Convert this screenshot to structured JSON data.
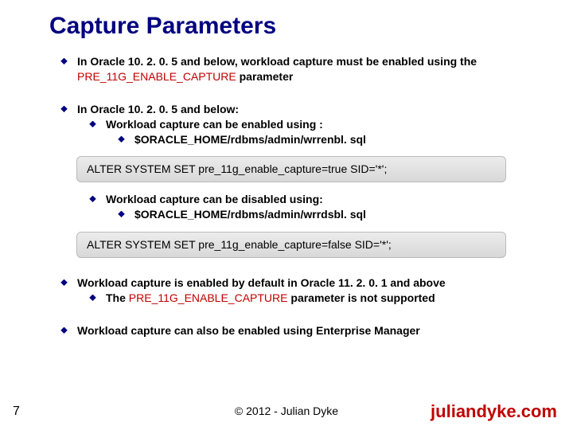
{
  "title": "Capture Parameters",
  "b1": {
    "pre": "In Oracle 10. 2. 0. 5 and below, workload capture must be enabled using the ",
    "param": "PRE_11G_ENABLE_CAPTURE",
    "post": " parameter"
  },
  "b2": "In Oracle 10. 2. 0. 5 and below:",
  "b2a": "Workload capture can be enabled using :",
  "b2a1": "$ORACLE_HOME/rdbms/admin/wrrenbl. sql",
  "code1": "ALTER SYSTEM SET pre_11g_enable_capture=true SID='*';",
  "b2b": "Workload capture can be disabled using:",
  "b2b1": "$ORACLE_HOME/rdbms/admin/wrrdsbl. sql",
  "code2": "ALTER SYSTEM SET pre_11g_enable_capture=false SID='*';",
  "b3": {
    "line1": "Workload capture  is enabled by default in Oracle 11. 2. 0. 1 and above",
    "sub_pre": "The ",
    "sub_param": "PRE_11G_ENABLE_CAPTURE",
    "sub_post": " parameter is not supported"
  },
  "b4": "Workload capture can also be enabled using Enterprise Manager",
  "page": "7",
  "copyright": "© 2012 - Julian Dyke",
  "site": "juliandyke.com"
}
